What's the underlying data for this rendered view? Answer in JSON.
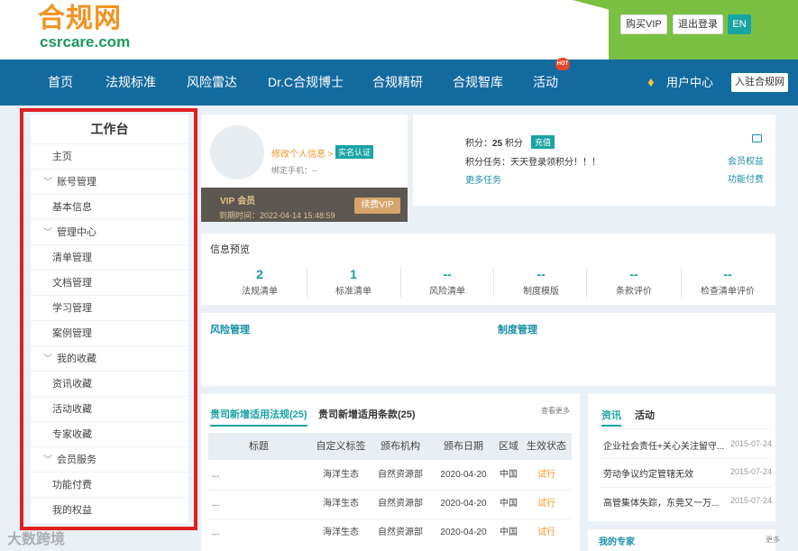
{
  "header": {
    "logo_cn": "合规网",
    "logo_en": "csrcare.com",
    "buy_vip": "购买VIP",
    "logout": "退出登录",
    "lang": "EN"
  },
  "nav": {
    "items": [
      "首页",
      "法规标准",
      "风险雷达",
      "Dr.C合规博士",
      "合规精研",
      "合规智库",
      "活动"
    ],
    "hot": "HOT",
    "user_center": "用户中心",
    "join": "入驻合规网"
  },
  "sidebar": {
    "title": "工作台",
    "items": [
      {
        "label": "主页",
        "type": "leaf"
      },
      {
        "label": "账号管理",
        "type": "group"
      },
      {
        "label": "基本信息",
        "type": "leaf"
      },
      {
        "label": "管理中心",
        "type": "group"
      },
      {
        "label": "清单管理",
        "type": "leaf"
      },
      {
        "label": "文档管理",
        "type": "leaf"
      },
      {
        "label": "学习管理",
        "type": "leaf"
      },
      {
        "label": "案例管理",
        "type": "leaf"
      },
      {
        "label": "我的收藏",
        "type": "group"
      },
      {
        "label": "资讯收藏",
        "type": "leaf"
      },
      {
        "label": "活动收藏",
        "type": "leaf"
      },
      {
        "label": "专家收藏",
        "type": "leaf"
      },
      {
        "label": "会员服务",
        "type": "group"
      },
      {
        "label": "功能付费",
        "type": "leaf"
      },
      {
        "label": "我的权益",
        "type": "leaf"
      }
    ]
  },
  "profile": {
    "edit_info": "修改个人信息 >",
    "real_auth": "实名认证",
    "bind_phone": "绑定手机：--",
    "vip_label": "VIP",
    "vip_member": "会员",
    "expire": "到期时间：2022-04-14 15:48:59",
    "renew": "续费VIP"
  },
  "points": {
    "label": "积分：",
    "value": "25",
    "unit": "积分",
    "recharge": "充值",
    "task": "积分任务：天天登录领积分！！！",
    "more_task": "更多任务",
    "member_rights": "会员权益",
    "func_pay": "功能付费"
  },
  "info_preview": {
    "title": "信息预览",
    "stats": [
      {
        "num": "2",
        "label": "法规清单"
      },
      {
        "num": "1",
        "label": "标准清单"
      },
      {
        "num": "--",
        "label": "风险清单"
      },
      {
        "num": "--",
        "label": "制度模版"
      },
      {
        "num": "--",
        "label": "条款评价"
      },
      {
        "num": "--",
        "label": "检查清单评价"
      }
    ]
  },
  "panels": {
    "risk": "风险管理",
    "system": "制度管理"
  },
  "regs": {
    "tab_active": "贵司新增适用法规(25)",
    "tab_inactive": "贵司新增适用条款(25)",
    "view_more": "查看更多",
    "columns": [
      "标题",
      "自定义标签",
      "颁布机构",
      "颁布日期",
      "区域",
      "生效状态"
    ],
    "rows": [
      [
        "...",
        "海洋生态",
        "自然资源部",
        "2020-04-20",
        "中国",
        "试行"
      ],
      [
        "...",
        "海洋生态",
        "自然资源部",
        "2020-04-20",
        "中国",
        "试行"
      ],
      [
        "...",
        "海洋生态",
        "自然资源部",
        "2020-04-20",
        "中国",
        "试行"
      ]
    ]
  },
  "news": {
    "tab_active": "资讯",
    "tab_inactive": "活动",
    "items": [
      {
        "title": "企业社会责任+关心关注留守...",
        "date": "2015-07-24"
      },
      {
        "title": "劳动争议约定管辖无效",
        "date": "2015-07-24"
      },
      {
        "title": "高管集体失踪，东莞又一万...",
        "date": "2015-07-24"
      }
    ],
    "my_expert": "我的专家",
    "more": "更多"
  },
  "watermark": "大数跨境"
}
